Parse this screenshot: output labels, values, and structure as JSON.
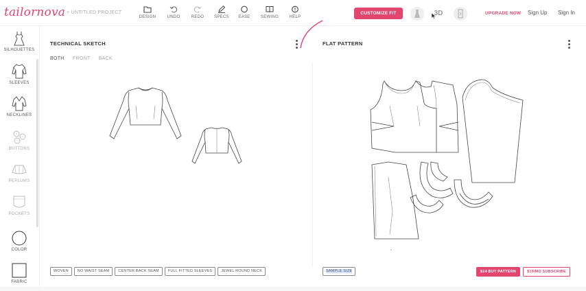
{
  "brand": {
    "logo": "tailornova",
    "accent_color": "#e2456e"
  },
  "breadcrumb": {
    "separator": ">",
    "project": "UNTITLED PROJECT"
  },
  "toolbar": {
    "tools": [
      {
        "label": "DESIGN",
        "icon": "folder-icon"
      },
      {
        "label": "UNDO",
        "icon": "undo-icon"
      },
      {
        "label": "REDO",
        "icon": "redo-icon"
      },
      {
        "label": "SPECS",
        "icon": "pencil-icon"
      },
      {
        "label": "EASE",
        "icon": "circle-icon"
      },
      {
        "label": "SEWING",
        "icon": "book-icon"
      },
      {
        "label": "HELP",
        "icon": "help-icon"
      }
    ],
    "customize_label": "CUSTOMIZE FIT",
    "view_3d_label": "3D",
    "upgrade_label": "UPGRADE NOW",
    "signup_label": "Sign Up",
    "signin_label": "Sign In"
  },
  "sidebar": {
    "items": [
      {
        "label": "SILHOUETTES",
        "icon": "dress-icon"
      },
      {
        "label": "SLEEVES",
        "icon": "sleeve-icon"
      },
      {
        "label": "NECKLINES",
        "icon": "neckline-icon"
      },
      {
        "label": "BUTTONS",
        "icon": "buttons-icon"
      },
      {
        "label": "PEPLUMS",
        "icon": "peplum-icon"
      },
      {
        "label": "POCKETS",
        "icon": "pocket-icon"
      },
      {
        "label": "COLOR",
        "icon": "color-circle-icon"
      },
      {
        "label": "FABRIC",
        "icon": "fabric-square-icon"
      }
    ]
  },
  "technical_sketch": {
    "title": "TECHNICAL SKETCH",
    "view_tabs": [
      "BOTH",
      "FRONT",
      "BACK"
    ],
    "active_tab": "BOTH",
    "features": [
      "WOVEN",
      "NO WAIST SEAM",
      "CENTER BACK SEAM",
      "FULL FITTED SLEEVES",
      "JEWEL ROUND NECK"
    ]
  },
  "flat_pattern": {
    "title": "FLAT PATTERN",
    "size_label": "SAMPLE SIZE",
    "buy_label": "$14 BUY PATTERN",
    "subscribe_label": "$19/MO SUBSCRIBE"
  }
}
